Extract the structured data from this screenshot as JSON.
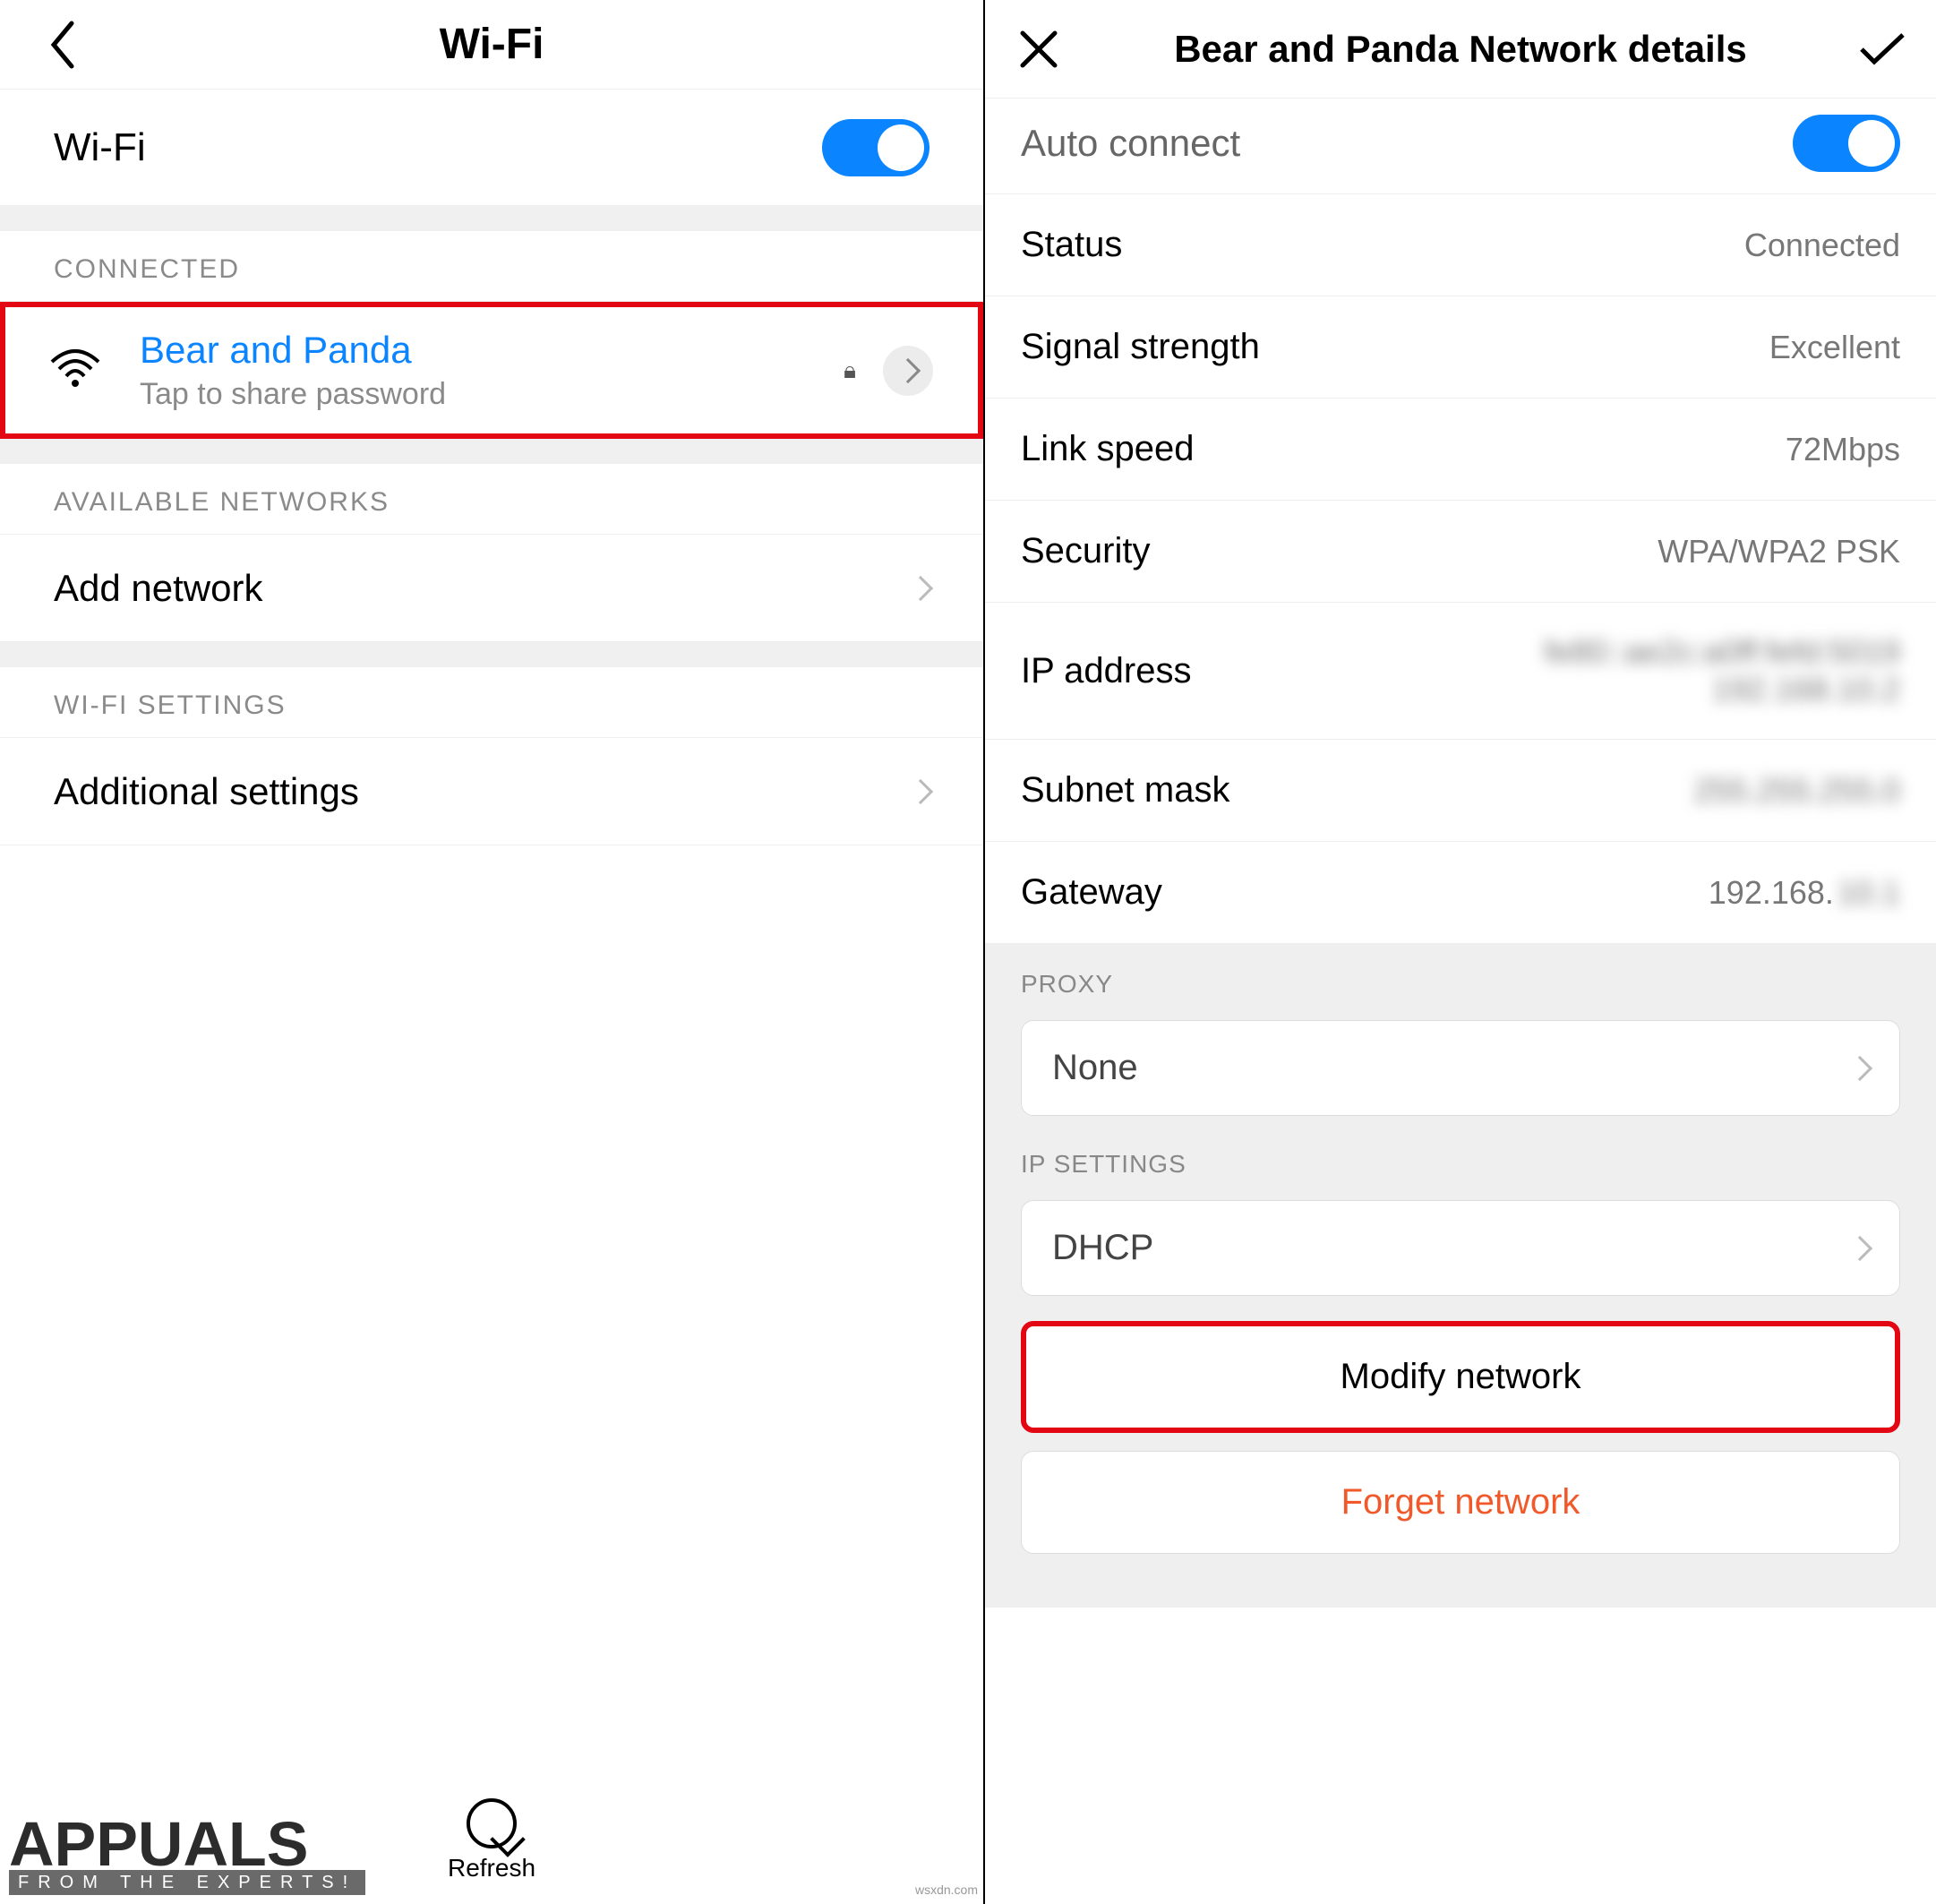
{
  "left": {
    "header_title": "Wi-Fi",
    "wifi_toggle_label": "Wi-Fi",
    "wifi_toggle_on": true,
    "section_connected": "CONNECTED",
    "connected": {
      "name": "Bear and Panda",
      "subtitle": "Tap to share password"
    },
    "section_available": "AVAILABLE NETWORKS",
    "add_network": "Add network",
    "section_settings": "WI-FI SETTINGS",
    "additional": "Additional settings",
    "refresh": "Refresh",
    "watermark_main": "APPUALS",
    "watermark_sub": "FROM THE EXPERTS!",
    "attribution": "wsxdn.com"
  },
  "right": {
    "header_title": "Bear and Panda Network details",
    "auto_connect": "Auto connect",
    "rows": {
      "status_k": "Status",
      "status_v": "Connected",
      "signal_k": "Signal strength",
      "signal_v": "Excellent",
      "speed_k": "Link speed",
      "speed_v": "72Mbps",
      "sec_k": "Security",
      "sec_v": "WPA/WPA2 PSK",
      "ip_k": "IP address",
      "ip_v": "fe80::ae2c:a0ff:fefd:5019\n192.168.10.2",
      "mask_k": "Subnet mask",
      "mask_v": "255.255.255.0",
      "gw_k": "Gateway",
      "gw_v_vis": "192.168.",
      "gw_v_hidden": "10.1"
    },
    "section_proxy": "PROXY",
    "proxy_value": "None",
    "section_ip": "IP SETTINGS",
    "ip_settings_value": "DHCP",
    "modify": "Modify network",
    "forget": "Forget network"
  }
}
